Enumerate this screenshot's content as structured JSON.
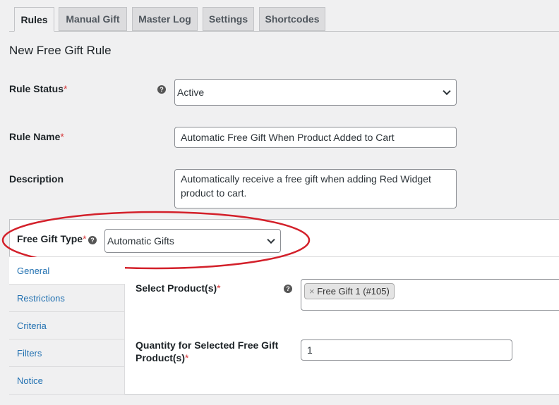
{
  "tabs": [
    {
      "label": "Rules",
      "active": true
    },
    {
      "label": "Manual Gift"
    },
    {
      "label": "Master Log"
    },
    {
      "label": "Settings"
    },
    {
      "label": "Shortcodes"
    }
  ],
  "page_title": "New Free Gift Rule",
  "rule_status": {
    "label": "Rule Status",
    "required": "*",
    "value": "Active"
  },
  "rule_name": {
    "label": "Rule Name",
    "required": "*",
    "value": "Automatic Free Gift When Product Added to Cart"
  },
  "description": {
    "label": "Description",
    "value": "Automatically receive a free gift when adding Red Widget product to cart."
  },
  "gift_type": {
    "label": "Free Gift Type",
    "required": "*",
    "value": "Automatic Gifts",
    "highlight_color": "#d3202a"
  },
  "side_nav": [
    "General",
    "Restrictions",
    "Criteria",
    "Filters",
    "Notice"
  ],
  "select_products": {
    "label": "Select Product(s)",
    "required": "*",
    "tag_remove": "×",
    "tag": "Free Gift 1 (#105)"
  },
  "quantity": {
    "label_line1": "Quantity for Selected Free Gift",
    "label_line2": "Product(s)",
    "required": "*",
    "value": "1"
  },
  "help_glyph": "?"
}
